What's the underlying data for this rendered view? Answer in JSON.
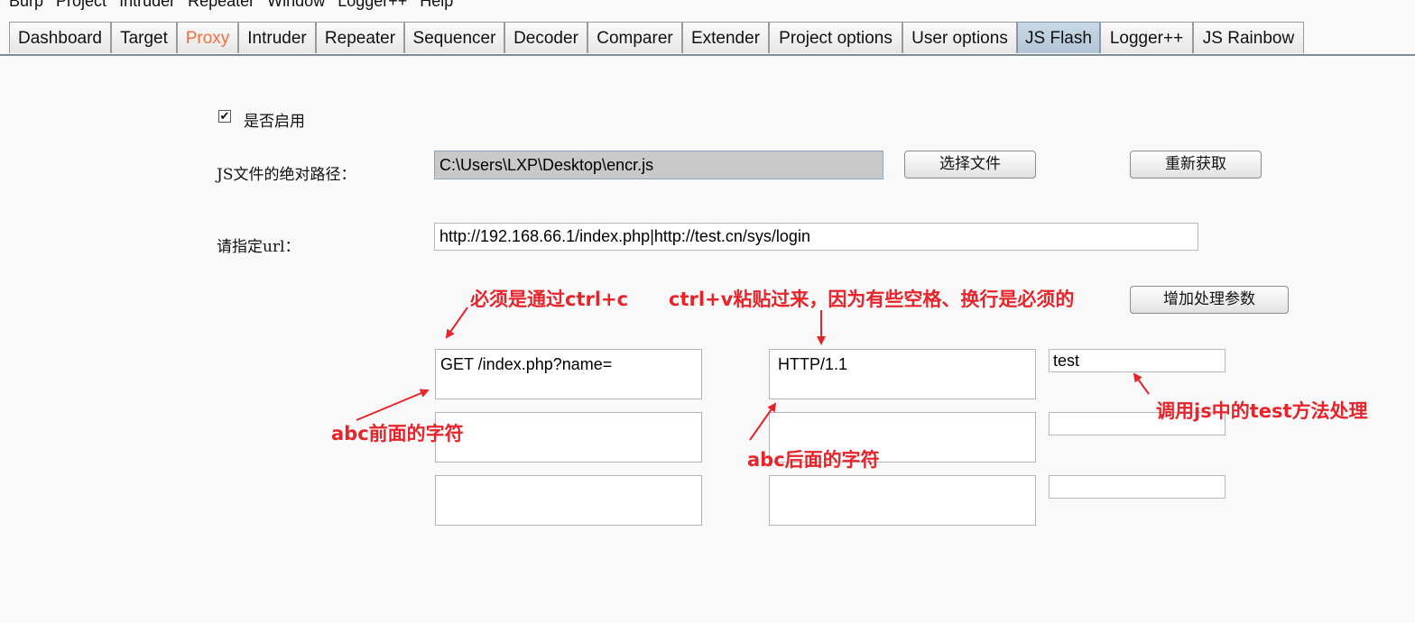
{
  "menu": [
    "Burp",
    "Project",
    "Intruder",
    "Repeater",
    "Window",
    "Logger++",
    "Help"
  ],
  "tabs": [
    "Dashboard",
    "Target",
    "Proxy",
    "Intruder",
    "Repeater",
    "Sequencer",
    "Decoder",
    "Comparer",
    "Extender",
    "Project options",
    "User options",
    "JS Flash",
    "Logger++",
    "JS Rainbow"
  ],
  "active_tab": "JS Flash",
  "colors": {
    "proxy_tab": "#f0703a",
    "annotation": "#e8242b",
    "active_tab_bg": "#b9cadb"
  },
  "form": {
    "enable_label": "是否启用",
    "enable_checked": true,
    "js_path_label": "JS文件的绝对路径：",
    "js_path_value": "C:\\Users\\LXP\\Desktop\\encr.js",
    "choose_file_button": "选择文件",
    "reload_button": "重新获取",
    "url_label": "请指定url：",
    "url_value": "http://192.168.66.1/index.php|http://test.cn/sys/login",
    "add_param_button": "增加处理参数",
    "rows": [
      {
        "prefix": "GET /index.php?name=",
        "suffix": "HTTP/1.1",
        "method": "test"
      },
      {
        "prefix": "",
        "suffix": "",
        "method": ""
      },
      {
        "prefix": "",
        "suffix": "",
        "method": ""
      }
    ]
  },
  "annotations": {
    "ctrl_c": "必须是通过ctrl+c",
    "ctrl_v": "ctrl+v粘贴过来，因为有些空格、换行是必须的",
    "before_abc": "abc前面的字符",
    "after_abc": "abc后面的字符",
    "test_method": "调用js中的test方法处理"
  }
}
